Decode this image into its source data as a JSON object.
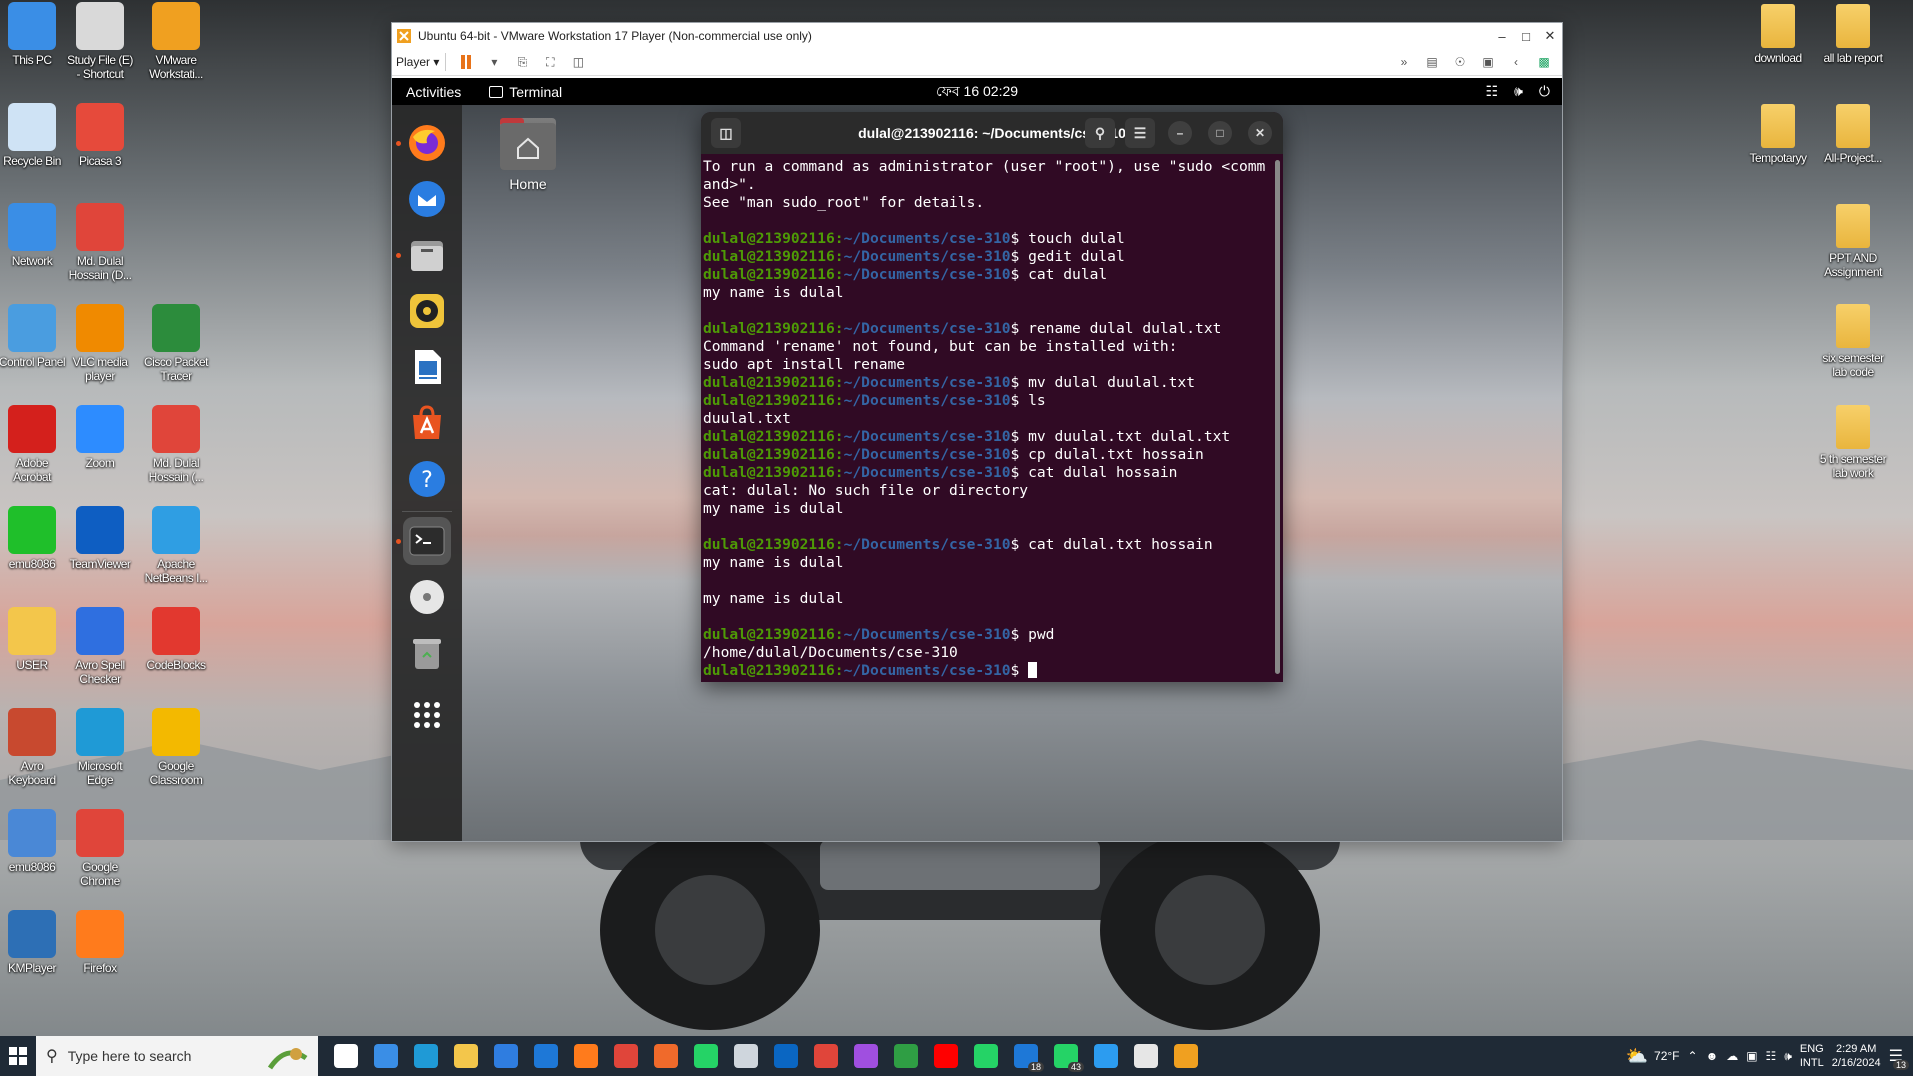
{
  "desktop_icons_left": [
    {
      "label": "This PC",
      "icon": "this-pc-icon",
      "color": "#3a8ee6"
    },
    {
      "label": "Study File (E)\n- Shortcut",
      "icon": "drive-icon",
      "color": "#d9d9d9"
    },
    {
      "label": "VMware\nWorkstati...",
      "icon": "vmware-icon",
      "color": "#f0a020"
    },
    {
      "label": "Recycle Bin",
      "icon": "recycle-bin-icon",
      "color": "#cfe3f5"
    },
    {
      "label": "Picasa 3",
      "icon": "picasa-icon",
      "color": "#e64a3b"
    },
    {
      "label": "Network",
      "icon": "network-icon",
      "color": "#3a8ee6"
    },
    {
      "label": "Md. Dulal\nHossain (D...",
      "icon": "chrome-profile-icon",
      "color": "#e0453a"
    },
    {
      "label": "Control Panel",
      "icon": "control-panel-icon",
      "color": "#4a9de0"
    },
    {
      "label": "VLC media\nplayer",
      "icon": "vlc-icon",
      "color": "#f08a00"
    },
    {
      "label": "Cisco Packet\nTracer",
      "icon": "cisco-packet-tracer-icon",
      "color": "#2c8c3c"
    },
    {
      "label": "Adobe\nAcrobat",
      "icon": "adobe-acrobat-icon",
      "color": "#d4201c"
    },
    {
      "label": "Zoom",
      "icon": "zoom-icon",
      "color": "#2d8cff"
    },
    {
      "label": "Md. Dulal\nHossain (...",
      "icon": "chrome-profile-icon",
      "color": "#e0453a"
    },
    {
      "label": "emu8086",
      "icon": "emu8086-icon",
      "color": "#1fbf2a"
    },
    {
      "label": "TeamViewer",
      "icon": "teamviewer-icon",
      "color": "#0e5ec2"
    },
    {
      "label": "Apache\nNetBeans I...",
      "icon": "netbeans-icon",
      "color": "#2f9ee3"
    },
    {
      "label": "USER",
      "icon": "user-folder-icon",
      "color": "#f3c64b"
    },
    {
      "label": "Avro Spell\nChecker",
      "icon": "avro-spell-checker-icon",
      "color": "#2f6fe0"
    },
    {
      "label": "CodeBlocks",
      "icon": "codeblocks-icon",
      "color": "#e2382f"
    },
    {
      "label": "Avro\nKeyboard",
      "icon": "avro-keyboard-icon",
      "color": "#c8492f"
    },
    {
      "label": "Microsoft\nEdge",
      "icon": "edge-icon",
      "color": "#1f9ad6"
    },
    {
      "label": "Google\nClassroom",
      "icon": "google-classroom-icon",
      "color": "#f3b900"
    },
    {
      "label": "emu8086",
      "icon": "emu8086-shortcut-icon",
      "color": "#4a88d6"
    },
    {
      "label": "Google\nChrome",
      "icon": "chrome-icon",
      "color": "#e0453a"
    },
    {
      "label": "KMPlayer",
      "icon": "kmplayer-icon",
      "color": "#2d6fb5"
    },
    {
      "label": "Firefox",
      "icon": "firefox-icon",
      "color": "#ff7b1c"
    }
  ],
  "desktop_icons_right": [
    {
      "label": "download",
      "icon": "folder-icon"
    },
    {
      "label": "all lab report",
      "icon": "folder-icon"
    },
    {
      "label": "Tempotaryy",
      "icon": "folder-icon"
    },
    {
      "label": "All-Project...",
      "icon": "folder-icon"
    },
    {
      "label": "PPT AND\nAssignment",
      "icon": "folder-icon"
    },
    {
      "label": "six semester\nlab code",
      "icon": "folder-icon"
    },
    {
      "label": "5 th semester\nlab work",
      "icon": "folder-icon"
    }
  ],
  "vmware": {
    "title": "Ubuntu 64-bit - VMware Workstation 17 Player (Non-commercial use only)",
    "player_menu": "Player"
  },
  "ubuntu": {
    "activities": "Activities",
    "app_name": "Terminal",
    "clock": "ফেব 16  02:29",
    "home_label": "Home"
  },
  "terminal": {
    "title": "dulal@213902116: ~/Documents/cse-310",
    "prompt_user": "dulal@213902116",
    "prompt_path": "~/Documents/cse-310",
    "lines": [
      {
        "type": "out",
        "text": "To run a command as administrator (user \"root\"), use \"sudo <comm"
      },
      {
        "type": "out",
        "text": "and>\"."
      },
      {
        "type": "out",
        "text": "See \"man sudo_root\" for details."
      },
      {
        "type": "out",
        "text": ""
      },
      {
        "type": "cmd",
        "text": "touch dulal"
      },
      {
        "type": "cmd",
        "text": "gedit dulal"
      },
      {
        "type": "cmd",
        "text": "cat dulal"
      },
      {
        "type": "out",
        "text": "my name is dulal"
      },
      {
        "type": "out",
        "text": ""
      },
      {
        "type": "cmd",
        "text": "rename dulal dulal.txt"
      },
      {
        "type": "out",
        "text": "Command 'rename' not found, but can be installed with:"
      },
      {
        "type": "out",
        "text": "sudo apt install rename"
      },
      {
        "type": "cmd",
        "text": "mv dulal duulal.txt"
      },
      {
        "type": "cmd",
        "text": "ls"
      },
      {
        "type": "out",
        "text": "duulal.txt"
      },
      {
        "type": "cmd",
        "text": "mv duulal.txt dulal.txt"
      },
      {
        "type": "cmd",
        "text": "cp dulal.txt hossain"
      },
      {
        "type": "cmd",
        "text": "cat dulal hossain"
      },
      {
        "type": "out",
        "text": "cat: dulal: No such file or directory"
      },
      {
        "type": "out",
        "text": "my name is dulal"
      },
      {
        "type": "out",
        "text": ""
      },
      {
        "type": "cmd",
        "text": "cat dulal.txt hossain"
      },
      {
        "type": "out",
        "text": "my name is dulal"
      },
      {
        "type": "out",
        "text": ""
      },
      {
        "type": "out",
        "text": "my name is dulal"
      },
      {
        "type": "out",
        "text": ""
      },
      {
        "type": "cmd",
        "text": "pwd"
      },
      {
        "type": "out",
        "text": "/home/dulal/Documents/cse-310"
      },
      {
        "type": "cursor",
        "text": ""
      }
    ]
  },
  "taskbar": {
    "search_placeholder": "Type here to search",
    "apps": [
      {
        "name": "task-view-icon",
        "color": "#ffffff"
      },
      {
        "name": "files-app-icon",
        "color": "#3a8ee6"
      },
      {
        "name": "edge-icon",
        "color": "#1f9ad6"
      },
      {
        "name": "file-explorer-icon",
        "color": "#f3c64b"
      },
      {
        "name": "store-icon",
        "color": "#2f7de0"
      },
      {
        "name": "mail-icon",
        "color": "#1e78d7"
      },
      {
        "name": "firefox-icon",
        "color": "#ff7b1c"
      },
      {
        "name": "chrome-profile-icon",
        "color": "#e0453a"
      },
      {
        "name": "brave-icon",
        "color": "#f06a2b"
      },
      {
        "name": "whatsapp-icon",
        "color": "#25d366"
      },
      {
        "name": "weather-app-icon",
        "color": "#cfd6dd"
      },
      {
        "name": "linkedin-icon",
        "color": "#0a66c2"
      },
      {
        "name": "chrome-icon",
        "color": "#e0453a"
      },
      {
        "name": "messenger-icon",
        "color": "#a04fe0"
      },
      {
        "name": "photos-icon",
        "color": "#2f9e44"
      },
      {
        "name": "youtube-icon",
        "color": "#ff0000"
      },
      {
        "name": "whatsapp-icon",
        "color": "#25d366"
      },
      {
        "name": "outlook-icon",
        "color": "#1e78d7",
        "badge": "18"
      },
      {
        "name": "whatsapp-business-icon",
        "color": "#25d366",
        "badge": "43"
      },
      {
        "name": "vscode-icon",
        "color": "#2c9cf0"
      },
      {
        "name": "media-player-icon",
        "color": "#e6e6e6"
      },
      {
        "name": "vmware-icon",
        "color": "#f0a020"
      }
    ],
    "weather": "72°F",
    "lang_top": "ENG",
    "lang_bottom": "INTL",
    "time": "2:29 AM",
    "date": "2/16/2024",
    "notifications": "13"
  }
}
